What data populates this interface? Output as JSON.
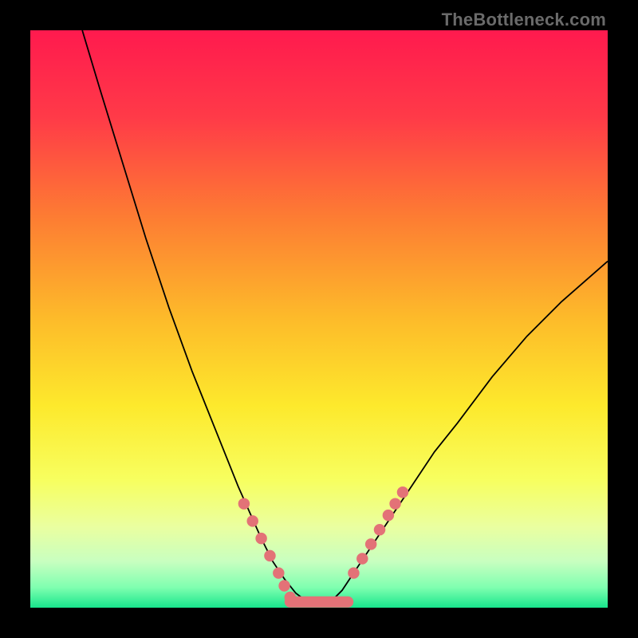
{
  "watermark": "TheBottleneck.com",
  "chart_data": {
    "type": "line",
    "title": "",
    "xlabel": "",
    "ylabel": "",
    "xlim": [
      0,
      100
    ],
    "ylim": [
      0,
      100
    ],
    "grid": false,
    "legend": false,
    "annotations": [],
    "series": [
      {
        "name": "curve-left",
        "color": "#000000",
        "x": [
          9,
          12,
          16,
          20,
          24,
          28,
          32,
          36,
          40,
          42,
          44,
          46,
          48
        ],
        "values": [
          100,
          90,
          77,
          64,
          52,
          41,
          31,
          21,
          12,
          8,
          5,
          2.5,
          1
        ]
      },
      {
        "name": "curve-right",
        "color": "#000000",
        "x": [
          52,
          54,
          56,
          58,
          62,
          66,
          70,
          74,
          80,
          86,
          92,
          100
        ],
        "values": [
          1,
          3,
          6,
          9,
          15,
          21,
          27,
          32,
          40,
          47,
          53,
          60
        ]
      },
      {
        "name": "flat-bottom",
        "color": "#e37277",
        "x": [
          45,
          55
        ],
        "values": [
          1,
          1
        ]
      },
      {
        "name": "dots-left",
        "color": "#e37277",
        "x": [
          37,
          38.5,
          40,
          41.5,
          43,
          44,
          45
        ],
        "values": [
          18,
          15,
          12,
          9,
          6,
          3.8,
          1.8
        ]
      },
      {
        "name": "dots-right",
        "color": "#e37277",
        "x": [
          56,
          57.5,
          59,
          60.5,
          62,
          63.2,
          64.5
        ],
        "values": [
          6,
          8.5,
          11,
          13.5,
          16,
          18,
          20
        ]
      }
    ],
    "background_gradient": {
      "type": "vertical",
      "stops": [
        {
          "offset": 0.0,
          "color": "#ff1a4e"
        },
        {
          "offset": 0.15,
          "color": "#ff3a48"
        },
        {
          "offset": 0.32,
          "color": "#fd7b33"
        },
        {
          "offset": 0.5,
          "color": "#fdbb2a"
        },
        {
          "offset": 0.65,
          "color": "#fde92c"
        },
        {
          "offset": 0.78,
          "color": "#f7ff60"
        },
        {
          "offset": 0.86,
          "color": "#eaffa0"
        },
        {
          "offset": 0.92,
          "color": "#c8ffc0"
        },
        {
          "offset": 0.965,
          "color": "#7fffb0"
        },
        {
          "offset": 1.0,
          "color": "#18e58c"
        }
      ]
    }
  }
}
